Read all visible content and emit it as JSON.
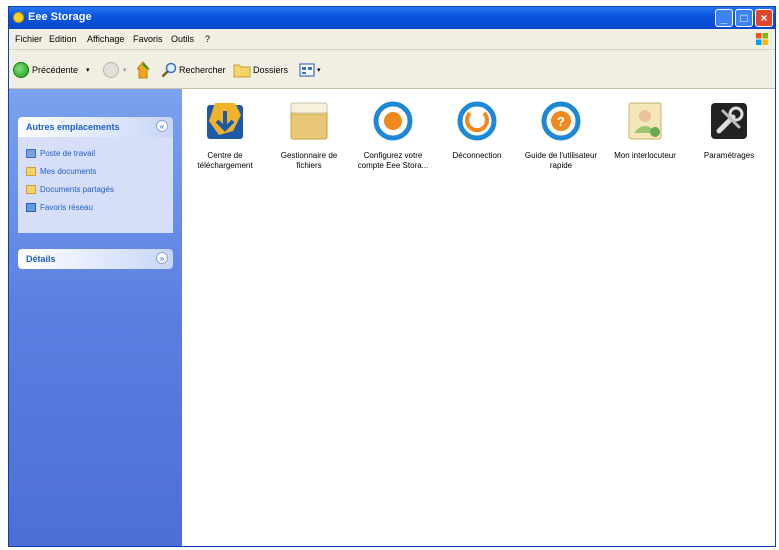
{
  "window": {
    "title": "Eee Storage"
  },
  "menu": [
    "Fichier",
    "Edition",
    "Affichage",
    "Favoris",
    "Outils",
    "?"
  ],
  "toolbar": {
    "back": "Précédente",
    "search": "Rechercher",
    "folders": "Dossiers"
  },
  "sidebar": {
    "other_places": {
      "title": "Autres emplacements",
      "links": [
        "Poste de travail",
        "Mes documents",
        "Documents partagés",
        "Favoris réseau"
      ]
    },
    "details": {
      "title": "Détails"
    }
  },
  "items": [
    {
      "label": "Centre de téléchargement",
      "icon": "download-center-icon"
    },
    {
      "label": "Gestionnaire de fichiers",
      "icon": "file-manager-icon"
    },
    {
      "label": "Configurez votre compte Eee Stora...",
      "icon": "configure-account-icon"
    },
    {
      "label": "Déconnection",
      "icon": "disconnect-icon"
    },
    {
      "label": "Guide de l'utilisateur rapide",
      "icon": "quick-guide-icon"
    },
    {
      "label": "Mon interlocuteur",
      "icon": "contact-icon"
    },
    {
      "label": "Paramétrages",
      "icon": "settings-icon"
    }
  ],
  "colors": {
    "titlebar": "#0a55e0",
    "sidebar": "#5a7ee0",
    "link": "#215dc6",
    "accent": "#f08a1e"
  }
}
